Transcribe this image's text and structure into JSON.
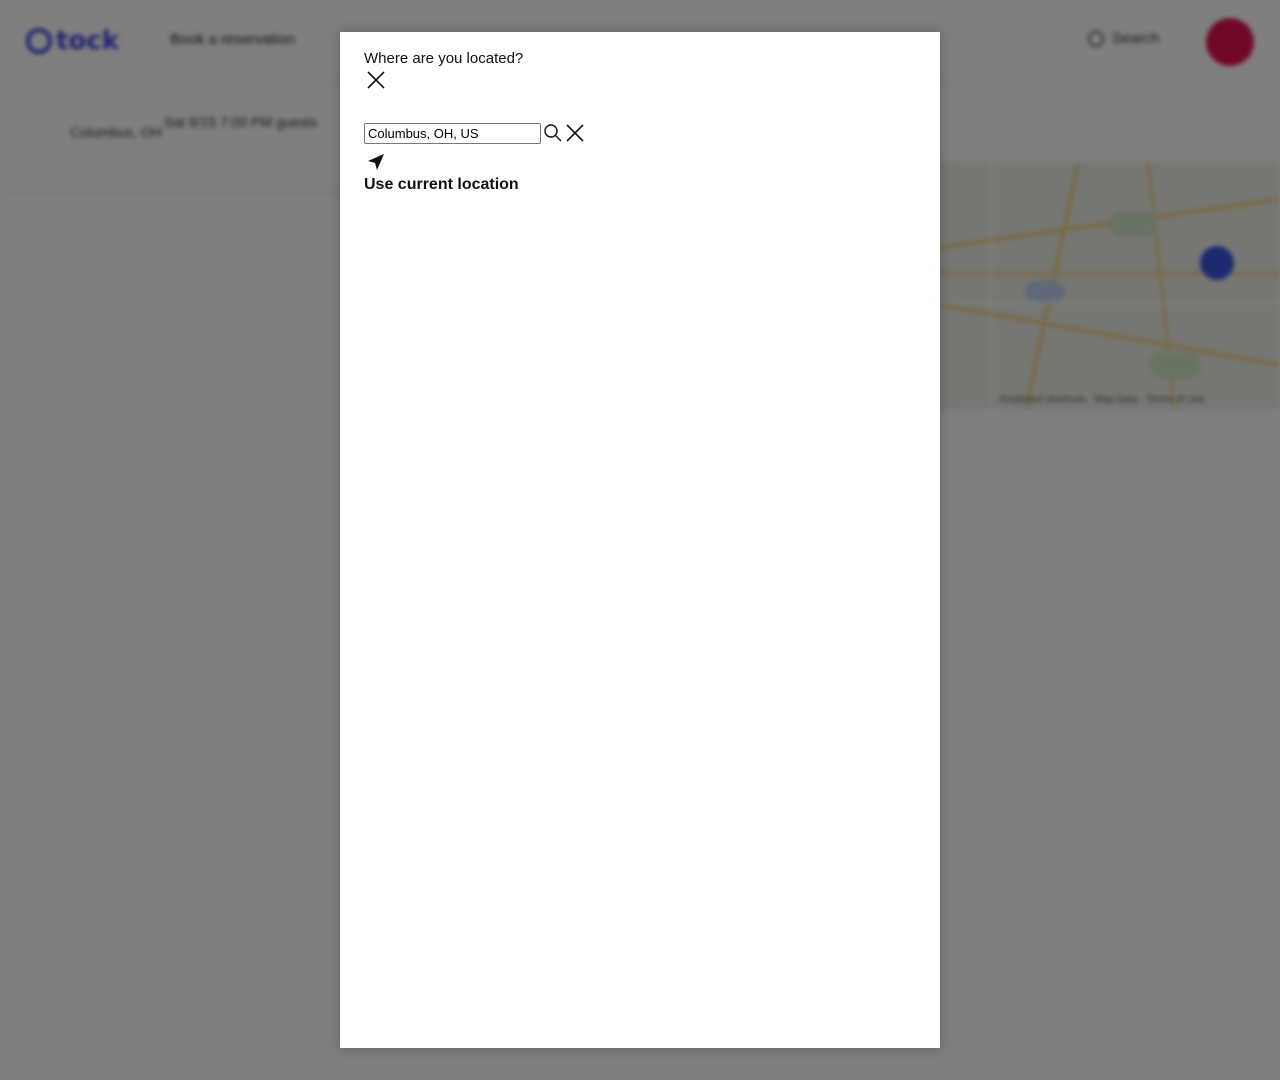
{
  "background": {
    "logo_text": "tock",
    "nav_link": "Book a reservation",
    "search_label": "Search",
    "filters": {
      "location_label": "Columbus, OH",
      "when_label": "Sat 6/15 7:00 PM guests"
    },
    "colors": {
      "brand": "#3a3fe0",
      "avatar": "#e0134f",
      "map_pin": "#3a55e0"
    }
  },
  "dialog": {
    "title": "Where are you located?",
    "close_icon": "close-icon",
    "search": {
      "value": "Columbus, OH, US",
      "search_icon": "search-icon",
      "clear_icon": "close-icon"
    },
    "current_location": {
      "icon": "navigation-arrow-icon",
      "label": "Use current location"
    }
  }
}
